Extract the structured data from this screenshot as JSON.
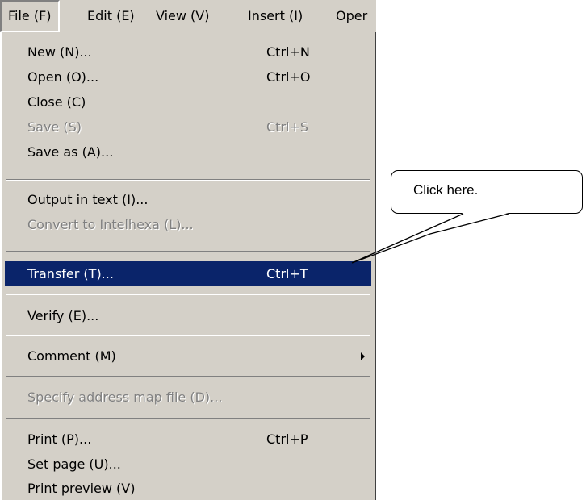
{
  "menubar": {
    "items": [
      {
        "label": "File (F)"
      },
      {
        "label": "Edit (E)"
      },
      {
        "label": "View (V)"
      },
      {
        "label": "Insert (I)"
      },
      {
        "label": "Oper"
      }
    ]
  },
  "file_menu": {
    "new": {
      "label": "New (N)...",
      "shortcut": "Ctrl+N"
    },
    "open": {
      "label": "Open (O)...",
      "shortcut": "Ctrl+O"
    },
    "close": {
      "label": "Close (C)"
    },
    "save": {
      "label": "Save (S)",
      "shortcut": "Ctrl+S"
    },
    "save_as": {
      "label": "Save as (A)..."
    },
    "output_text": {
      "label": "Output in text (I)..."
    },
    "convert": {
      "label": "Convert to Intelhexa (L)..."
    },
    "transfer": {
      "label": "Transfer (T)...",
      "shortcut": "Ctrl+T"
    },
    "verify": {
      "label": "Verify (E)..."
    },
    "comment": {
      "label": "Comment (M)"
    },
    "address_map": {
      "label": "Specify address map file (D)..."
    },
    "print": {
      "label": "Print (P)...",
      "shortcut": "Ctrl+P"
    },
    "set_page": {
      "label": "Set page (U)..."
    },
    "print_preview": {
      "label": "Print preview (V)"
    }
  },
  "callout": {
    "text": "Click here."
  },
  "colors": {
    "menu_bg": "#d4d0c8",
    "highlight": "#0a246a",
    "disabled": "#808080"
  }
}
